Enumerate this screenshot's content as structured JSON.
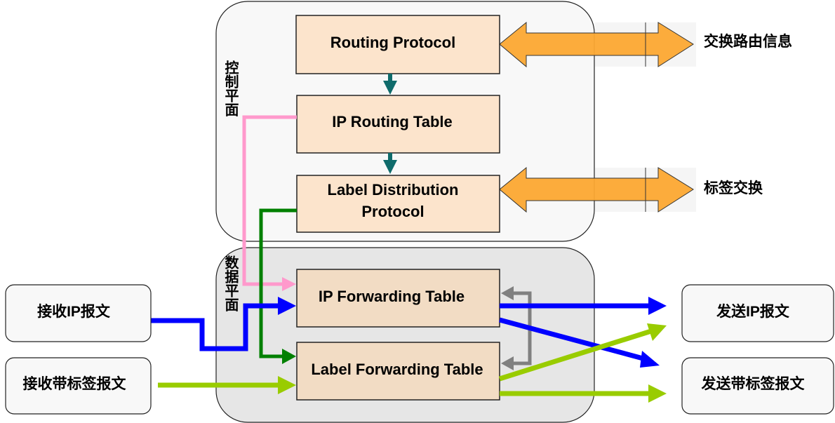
{
  "planes": {
    "control": {
      "label": "控制平面",
      "fill": "#f8f8f8"
    },
    "data": {
      "label": "数据平面",
      "fill": "#e6e6e6"
    }
  },
  "control_boxes": {
    "routing_protocol": "Routing Protocol",
    "ip_routing_table": "IP Routing Table",
    "ldp_line1": "Label Distribution",
    "ldp_line2": "Protocol"
  },
  "data_boxes": {
    "ip_forwarding_table": "IP Forwarding Table",
    "label_forwarding_table": "Label Forwarding Table"
  },
  "exchange": {
    "routing_info": "交换路由信息",
    "label": "标签交换"
  },
  "inputs": {
    "ip_packet": "接收IP报文",
    "labeled_packet": "接收带标签报文"
  },
  "outputs": {
    "ip_packet": "发送IP报文",
    "labeled_packet": "发送带标签报文"
  },
  "colors": {
    "control_box": "#fce4cc",
    "data_box": "#f2dcc4",
    "exchange_arrow": "#fca832",
    "teal": "#0f6b6b",
    "pink": "#ff99cc",
    "dark_green": "#008000",
    "blue": "#0000ff",
    "lime": "#99cc00",
    "gray": "#808080"
  }
}
